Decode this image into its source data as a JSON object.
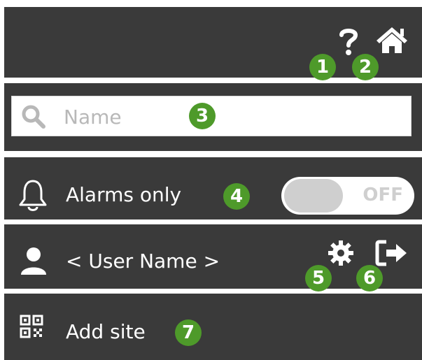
{
  "header": {
    "help_icon": "question-mark",
    "home_icon": "house",
    "badges": [
      "1",
      "2"
    ]
  },
  "search": {
    "placeholder": "Name",
    "badge": "3"
  },
  "alarms": {
    "label": "Alarms only",
    "toggle_state": "OFF",
    "badge": "4"
  },
  "user": {
    "name": "< User Name >",
    "badges": [
      "5",
      "6"
    ],
    "settings_icon": "gear",
    "logout_icon": "sign-out-arrow"
  },
  "site": {
    "label": "Add site",
    "badge": "7",
    "icon": "qr-code"
  },
  "colors": {
    "background": "#3a3a3a",
    "accent": "#4e9a2a",
    "toggle_off": "#cfcfcf"
  }
}
